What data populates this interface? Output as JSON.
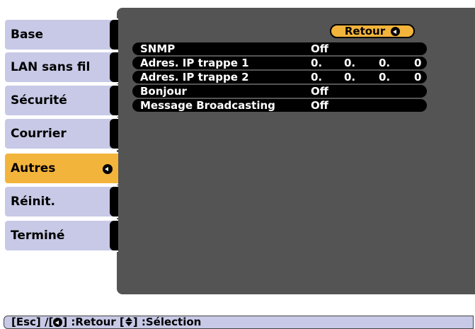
{
  "sidebar": {
    "items": [
      {
        "label": "Base"
      },
      {
        "label": "LAN sans fil"
      },
      {
        "label": "Sécurité"
      },
      {
        "label": "Courrier"
      },
      {
        "label": "Autres"
      },
      {
        "label": "Réinit."
      },
      {
        "label": "Terminé"
      }
    ],
    "selected_index": 4
  },
  "main": {
    "retour_label": "Retour",
    "settings": [
      {
        "label": "SNMP",
        "value": "Off"
      },
      {
        "label": "Adres. IP trappe 1",
        "ip": [
          "0.",
          "0.",
          "0.",
          "0"
        ]
      },
      {
        "label": "Adres. IP trappe 2",
        "ip": [
          "0.",
          "0.",
          "0.",
          "0"
        ]
      },
      {
        "label": "Bonjour",
        "value": "Off"
      },
      {
        "label": "Message Broadcasting",
        "value": "Off"
      }
    ]
  },
  "footer": {
    "esc": "[Esc] /[",
    "retour": "] :Retour  [",
    "selection": "] :Sélection"
  },
  "colors": {
    "tab": "#c7c9e6",
    "selected": "#f3b43c",
    "panel": "#545454"
  }
}
